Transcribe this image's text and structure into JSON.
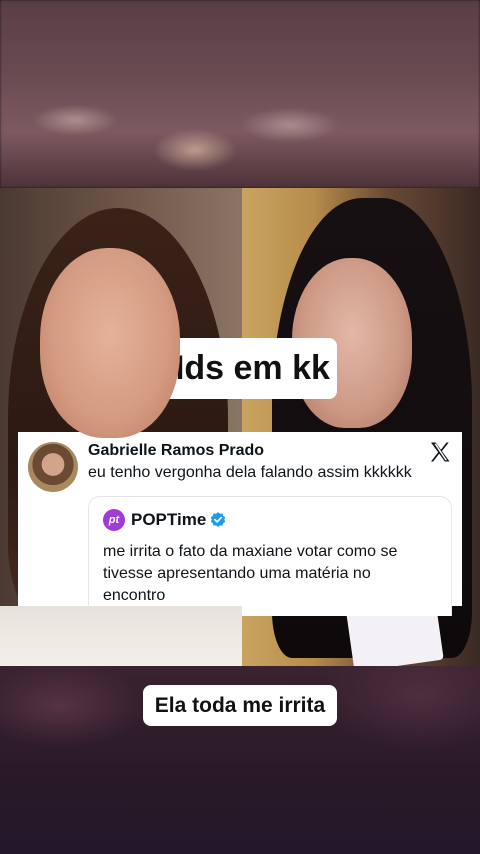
{
  "captions": {
    "top": "Mds em kk",
    "bottom": "Ela toda me irrita"
  },
  "tweet": {
    "author": "Gabrielle Ramos Prado",
    "text": "eu tenho vergonha dela falando assim kkkkkk",
    "platform_icon": "x-logo-icon",
    "quote": {
      "author": "POPTime",
      "logo_text": "pt",
      "verified": true,
      "text": "me irrita o fato da maxiane votar como se tivesse apresentando uma matéria no encontro"
    }
  },
  "colors": {
    "caption_bg": "#ffffff",
    "brand_purple": "#a13bd6",
    "verified_blue": "#1d9bf0"
  }
}
